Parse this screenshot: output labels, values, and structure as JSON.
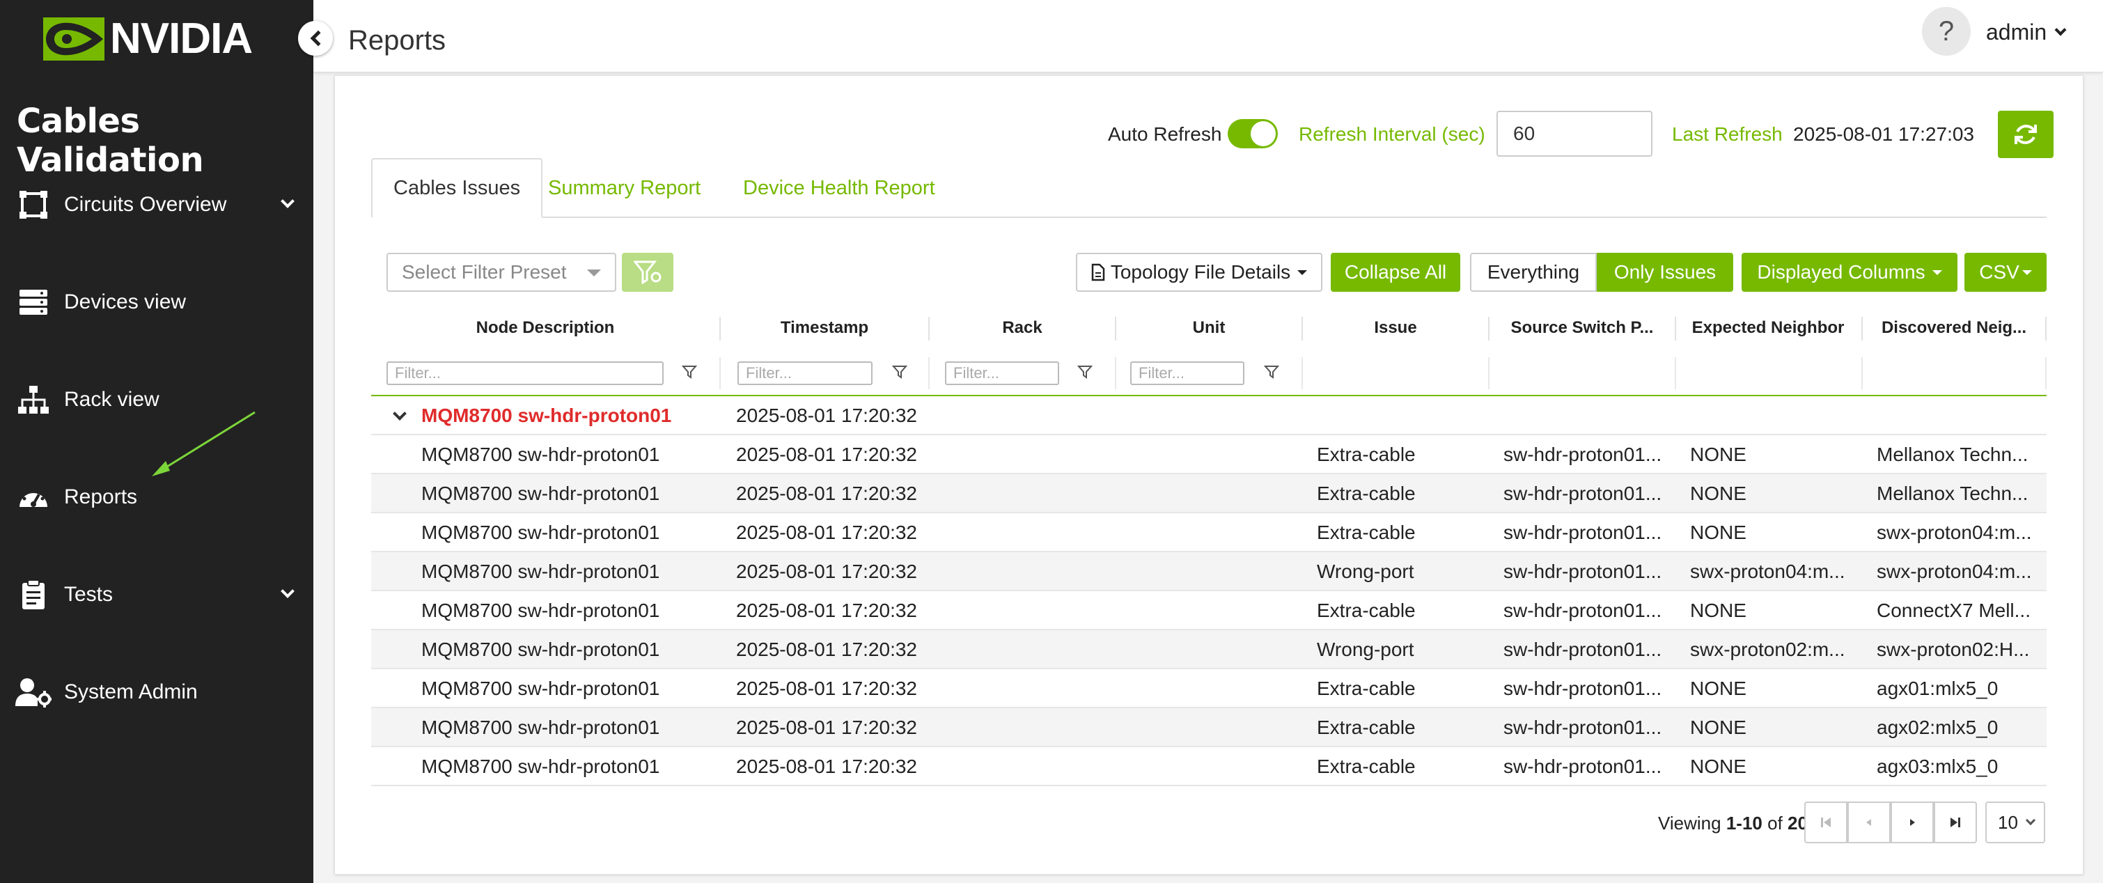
{
  "brand": {
    "logo_text": "NVIDIA",
    "app_title": "Cables Validation"
  },
  "sidebar": {
    "items": [
      {
        "label": "Circuits Overview",
        "icon": "circuit-icon",
        "has_submenu": true
      },
      {
        "label": "Devices view",
        "icon": "server-icon",
        "has_submenu": false
      },
      {
        "label": "Rack view",
        "icon": "network-icon",
        "has_submenu": false
      },
      {
        "label": "Reports",
        "icon": "gauge-icon",
        "has_submenu": false
      },
      {
        "label": "Tests",
        "icon": "clipboard-icon",
        "has_submenu": true
      },
      {
        "label": "System Admin",
        "icon": "user-gear-icon",
        "has_submenu": false
      }
    ]
  },
  "header": {
    "title": "Reports",
    "help": "?",
    "user": "admin"
  },
  "refresh": {
    "auto_label": "Auto Refresh",
    "auto_on": true,
    "interval_label": "Refresh Interval (sec)",
    "interval_value": "60",
    "last_label": "Last Refresh",
    "last_value": "2025-08-01 17:27:03"
  },
  "tabs": [
    {
      "label": "Cables Issues",
      "active": true
    },
    {
      "label": "Summary Report",
      "active": false
    },
    {
      "label": "Device Health Report",
      "active": false
    }
  ],
  "toolbar": {
    "preset_placeholder": "Select Filter Preset",
    "topology": "Topology File Details",
    "collapse": "Collapse All",
    "everything": "Everything",
    "only_issues": "Only Issues",
    "columns": "Displayed Columns",
    "csv": "CSV"
  },
  "table": {
    "columns": [
      "Node Description",
      "Timestamp",
      "Rack",
      "Unit",
      "Issue",
      "Source Switch P...",
      "Expected Neighbor",
      "Discovered Neig..."
    ],
    "filter_placeholder": "Filter...",
    "group": {
      "label": "MQM8700 sw-hdr-proton01",
      "timestamp": "2025-08-01 17:20:32"
    },
    "rows": [
      [
        "MQM8700 sw-hdr-proton01",
        "2025-08-01 17:20:32",
        "",
        "",
        "Extra-cable",
        "sw-hdr-proton01...",
        "NONE",
        "Mellanox Techn..."
      ],
      [
        "MQM8700 sw-hdr-proton01",
        "2025-08-01 17:20:32",
        "",
        "",
        "Extra-cable",
        "sw-hdr-proton01...",
        "NONE",
        "Mellanox Techn..."
      ],
      [
        "MQM8700 sw-hdr-proton01",
        "2025-08-01 17:20:32",
        "",
        "",
        "Extra-cable",
        "sw-hdr-proton01...",
        "NONE",
        "swx-proton04:m..."
      ],
      [
        "MQM8700 sw-hdr-proton01",
        "2025-08-01 17:20:32",
        "",
        "",
        "Wrong-port",
        "sw-hdr-proton01...",
        "swx-proton04:m...",
        "swx-proton04:m..."
      ],
      [
        "MQM8700 sw-hdr-proton01",
        "2025-08-01 17:20:32",
        "",
        "",
        "Extra-cable",
        "sw-hdr-proton01...",
        "NONE",
        "ConnectX7 Mell..."
      ],
      [
        "MQM8700 sw-hdr-proton01",
        "2025-08-01 17:20:32",
        "",
        "",
        "Wrong-port",
        "sw-hdr-proton01...",
        "swx-proton02:m...",
        "swx-proton02:H..."
      ],
      [
        "MQM8700 sw-hdr-proton01",
        "2025-08-01 17:20:32",
        "",
        "",
        "Extra-cable",
        "sw-hdr-proton01...",
        "NONE",
        "agx01:mlx5_0"
      ],
      [
        "MQM8700 sw-hdr-proton01",
        "2025-08-01 17:20:32",
        "",
        "",
        "Extra-cable",
        "sw-hdr-proton01...",
        "NONE",
        "agx02:mlx5_0"
      ],
      [
        "MQM8700 sw-hdr-proton01",
        "2025-08-01 17:20:32",
        "",
        "",
        "Extra-cable",
        "sw-hdr-proton01...",
        "NONE",
        "agx03:mlx5_0"
      ]
    ]
  },
  "pagination": {
    "viewing_prefix": "Viewing",
    "range": "1-10",
    "of": "of",
    "total": "20",
    "page_size": "10"
  },
  "colors": {
    "accent": "#76b900",
    "sidebar_bg": "#222222",
    "group_label": "#e02b2b"
  }
}
